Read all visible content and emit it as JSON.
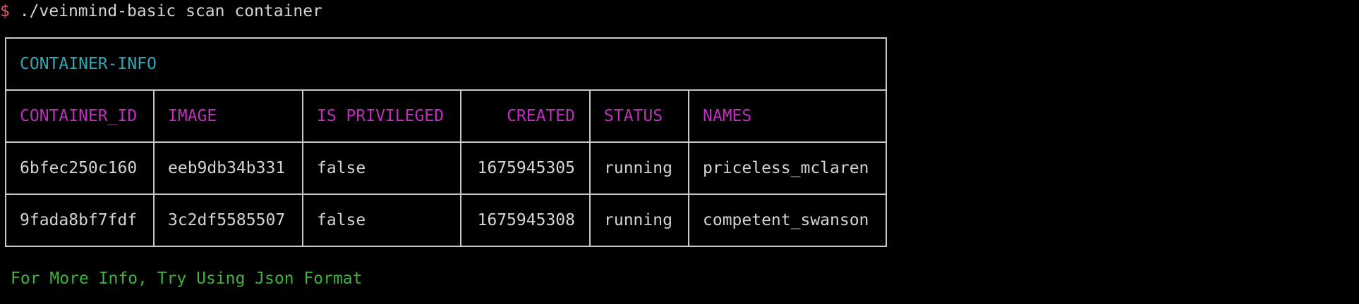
{
  "terminal": {
    "prompt_symbol": "$",
    "command": " ./veinmind-basic scan container"
  },
  "table": {
    "title": "CONTAINER-INFO",
    "headers": [
      "CONTAINER_ID",
      "IMAGE",
      "IS PRIVILEGED",
      "CREATED",
      "STATUS",
      "NAMES"
    ],
    "rows": [
      [
        "6bfec250c160",
        "eeb9db34b331",
        "false",
        "1675945305",
        "running",
        "priceless_mclaren"
      ],
      [
        "9fada8bf7fdf",
        "3c2df5585507",
        "false",
        "1675945308",
        "running",
        "competent_swanson"
      ]
    ]
  },
  "footer": {
    "message": "For More Info, Try Using Json Format"
  },
  "colors": {
    "background": "#000000",
    "prompt": "#e05561",
    "title": "#2ea8b4",
    "header": "#c02fbc",
    "footer": "#3ab53a",
    "border": "#c8c8c8"
  }
}
